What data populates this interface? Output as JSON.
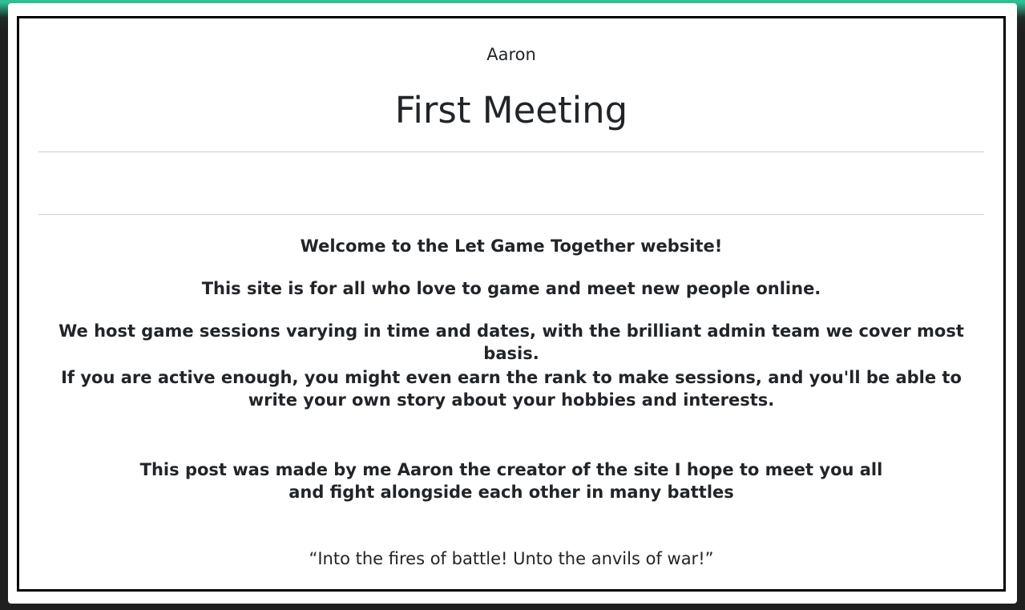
{
  "post": {
    "author": "Aaron",
    "title": "First Meeting",
    "welcome": "Welcome to the Let Game Together website!",
    "intro": "This site is for all who love to game and meet new people online.",
    "sessions": "We host game sessions varying in time and dates, with the brilliant admin team we cover most basis.",
    "rank": "If you are active enough, you might even earn the rank to make sessions, and you'll be able to write your own story about your hobbies and interests.",
    "signoff": "This post was made by me Aaron the creator of the site I hope to meet you all and fight alongside each other in many battles",
    "quote": "“Into the fires of battle! Unto the anvils of war!”"
  },
  "colors": {
    "accent": "#2fbf94",
    "border": "#000000",
    "text": "#212529",
    "divider": "#cfcfcf"
  }
}
